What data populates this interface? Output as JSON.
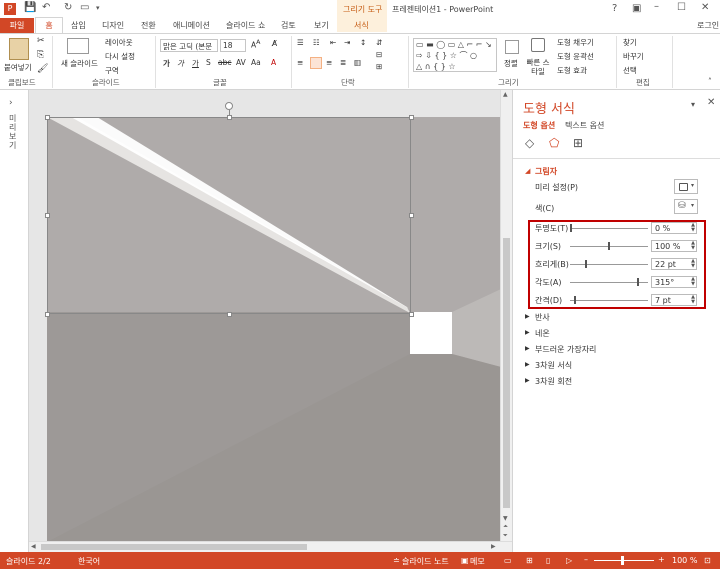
{
  "titlebar": {
    "ctx_group": "그리기 도구",
    "window_title": "프레젠테이션1 - PowerPoint",
    "login": "로그인"
  },
  "tabs": {
    "file": "파일",
    "home": "홈",
    "insert": "삽입",
    "design": "디자인",
    "transitions": "전환",
    "animations": "애니메이션",
    "slideshow": "슬라이드 쇼",
    "review": "검토",
    "view": "보기",
    "format": "서식"
  },
  "ribbon": {
    "paste": "붙여넣기",
    "new_slide": "새 슬라이드",
    "layout": "레이아웃",
    "reset": "다시 설정",
    "section": "구역",
    "font_name": "맑은 고딕 (본문",
    "font_size": "18",
    "arrange": "정렬",
    "quick_styles": "빠른 스타일",
    "shape_fill": "도형 채우기",
    "shape_outline": "도형 윤곽선",
    "shape_effects": "도형 효과",
    "find": "찾기",
    "replace": "바꾸기",
    "select": "선택",
    "groups": {
      "clipboard": "클립보드",
      "slides": "슬라이드",
      "font": "글꼴",
      "paragraph": "단락",
      "drawing": "그리기",
      "editing": "편집"
    }
  },
  "leftrail": {
    "label": "미리보기"
  },
  "pane": {
    "title": "도형 서식",
    "tab_shape": "도형 옵션",
    "tab_text": "텍스트 옵션",
    "shadow_header": "그림자",
    "preset_label": "미리 설정(P)",
    "color_label": "색(C)",
    "rows": [
      {
        "label": "투명도(T)",
        "value": "0 %",
        "level": 0
      },
      {
        "label": "크기(S)",
        "value": "100 %",
        "level": 0.5
      },
      {
        "label": "흐리게(B)",
        "value": "22 pt",
        "level": 0.2
      },
      {
        "label": "각도(A)",
        "value": "315°",
        "level": 0.88
      },
      {
        "label": "간격(D)",
        "value": "7 pt",
        "level": 0.05
      }
    ],
    "sections": [
      "반사",
      "네온",
      "부드러운 가장자리",
      "3차원 서식",
      "3차원 회전"
    ]
  },
  "status": {
    "slide": "슬라이드 2/2",
    "lang": "한국어",
    "notes": "슬라이드 노트",
    "comments": "메모",
    "zoom": "100 %"
  },
  "colors": {
    "accent": "#d24726",
    "highlight_box": "#c00000"
  }
}
